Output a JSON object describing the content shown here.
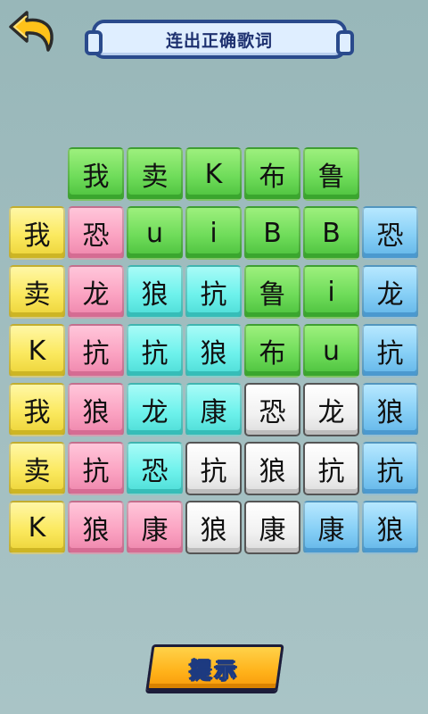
{
  "header": {
    "back_icon": "back-arrow-icon",
    "title": "连出正确歌词"
  },
  "grid": {
    "rows": [
      [
        null,
        {
          "char": "我",
          "color": "green"
        },
        {
          "char": "卖",
          "color": "green"
        },
        {
          "char": "K",
          "color": "green"
        },
        {
          "char": "布",
          "color": "green"
        },
        {
          "char": "鲁",
          "color": "green"
        },
        null
      ],
      [
        {
          "char": "我",
          "color": "yellow"
        },
        {
          "char": "恐",
          "color": "pink"
        },
        {
          "char": "u",
          "color": "green"
        },
        {
          "char": "i",
          "color": "green"
        },
        {
          "char": "B",
          "color": "green"
        },
        {
          "char": "B",
          "color": "green"
        },
        {
          "char": "恐",
          "color": "blue"
        }
      ],
      [
        {
          "char": "卖",
          "color": "yellow"
        },
        {
          "char": "龙",
          "color": "pink"
        },
        {
          "char": "狼",
          "color": "cyan"
        },
        {
          "char": "抗",
          "color": "cyan"
        },
        {
          "char": "鲁",
          "color": "green"
        },
        {
          "char": "i",
          "color": "green"
        },
        {
          "char": "龙",
          "color": "blue"
        }
      ],
      [
        {
          "char": "K",
          "color": "yellow"
        },
        {
          "char": "抗",
          "color": "pink"
        },
        {
          "char": "抗",
          "color": "cyan"
        },
        {
          "char": "狼",
          "color": "cyan"
        },
        {
          "char": "布",
          "color": "green"
        },
        {
          "char": "u",
          "color": "green"
        },
        {
          "char": "抗",
          "color": "blue"
        }
      ],
      [
        {
          "char": "我",
          "color": "yellow"
        },
        {
          "char": "狼",
          "color": "pink"
        },
        {
          "char": "龙",
          "color": "cyan"
        },
        {
          "char": "康",
          "color": "cyan"
        },
        {
          "char": "恐",
          "color": "white"
        },
        {
          "char": "龙",
          "color": "white"
        },
        {
          "char": "狼",
          "color": "blue"
        }
      ],
      [
        {
          "char": "卖",
          "color": "yellow"
        },
        {
          "char": "抗",
          "color": "pink"
        },
        {
          "char": "恐",
          "color": "cyan"
        },
        {
          "char": "抗",
          "color": "white"
        },
        {
          "char": "狼",
          "color": "white"
        },
        {
          "char": "抗",
          "color": "white"
        },
        {
          "char": "抗",
          "color": "blue"
        }
      ],
      [
        {
          "char": "K",
          "color": "yellow"
        },
        {
          "char": "狼",
          "color": "pink"
        },
        {
          "char": "康",
          "color": "pink"
        },
        {
          "char": "狼",
          "color": "white"
        },
        {
          "char": "康",
          "color": "white"
        },
        {
          "char": "康",
          "color": "blue"
        },
        {
          "char": "狼",
          "color": "blue"
        }
      ]
    ]
  },
  "footer": {
    "hint_label": "提示"
  }
}
